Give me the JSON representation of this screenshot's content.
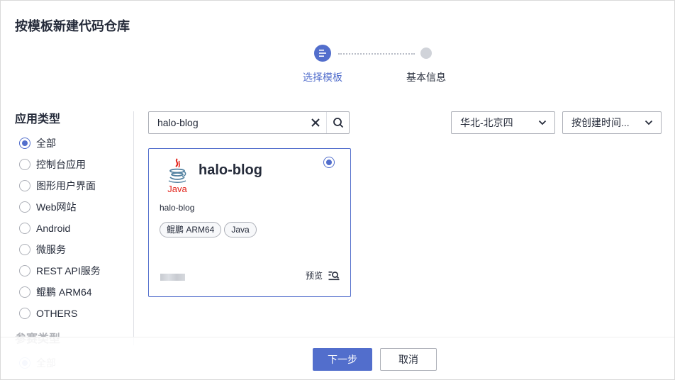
{
  "dialog": {
    "title": "按模板新建代码仓库"
  },
  "stepper": {
    "steps": [
      {
        "label": "选择模板",
        "state": "active"
      },
      {
        "label": "基本信息",
        "state": "pending"
      }
    ]
  },
  "filters": {
    "app_type": {
      "title": "应用类型",
      "options": [
        {
          "label": "全部",
          "checked": true
        },
        {
          "label": "控制台应用",
          "checked": false
        },
        {
          "label": "图形用户界面",
          "checked": false
        },
        {
          "label": "Web网站",
          "checked": false
        },
        {
          "label": "Android",
          "checked": false
        },
        {
          "label": "微服务",
          "checked": false
        },
        {
          "label": "REST API服务",
          "checked": false
        },
        {
          "label": "鲲鹏 ARM64",
          "checked": false
        },
        {
          "label": "OTHERS",
          "checked": false
        }
      ]
    },
    "contest_type": {
      "title": "参赛类型",
      "options": [
        {
          "label": "全部",
          "checked": true
        }
      ]
    }
  },
  "search": {
    "value": "halo-blog",
    "clear_icon": "close-icon",
    "search_icon": "search-icon"
  },
  "region_select": {
    "value": "华北-北京四"
  },
  "sort_select": {
    "value": "按创建时间..."
  },
  "templates": [
    {
      "name": "halo-blog",
      "logo": "java-logo",
      "logo_text": "Java",
      "description": "halo-blog",
      "tags": [
        "鲲鹏 ARM64",
        "Java"
      ],
      "selected": true,
      "preview_label": "预览"
    }
  ],
  "footer": {
    "next_label": "下一步",
    "cancel_label": "取消"
  },
  "colors": {
    "accent": "#526ecc",
    "java_red": "#e2231a",
    "java_blue": "#5382a1"
  }
}
